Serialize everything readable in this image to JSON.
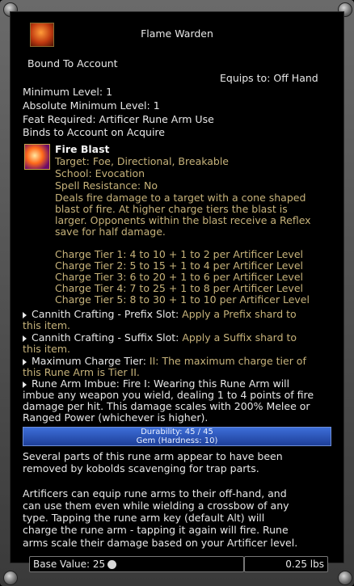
{
  "item": {
    "title": "Flame Warden",
    "bound": "Bound To Account",
    "equips": "Equips to: Off Hand",
    "min_level": "Minimum Level: 1",
    "abs_min_level": "Absolute Minimum Level: 1",
    "feat": "Feat Required: Artificer Rune Arm Use",
    "binds": "Binds to Account on Acquire"
  },
  "spell": {
    "name": "Fire Blast",
    "target": "Target: Foe, Directional, Breakable",
    "school": "School: Evocation",
    "resistance": "Spell Resistance: No",
    "desc": [
      "Deals fire damage to a target with a cone shaped",
      "blast of fire. At higher charge tiers the blast is",
      "larger. Opponents within the blast receive a Reflex",
      "save for half damage."
    ],
    "tiers": [
      "Charge Tier 1: 4 to 10 + 1 to 2 per Artificer Level",
      "Charge Tier 2: 5 to 15 + 1 to 4 per Artificer Level",
      "Charge Tier 3: 6 to 20 + 1 to 6 per Artificer Level",
      "Charge Tier 4: 7 to 25 + 1 to 8 per Artificer Level",
      "Charge Tier 5: 8 to 30 + 1 to 10 per Artificer Level"
    ]
  },
  "effects": [
    {
      "name": "Cannith Crafting - Prefix Slot:",
      "text1": "Apply a Prefix shard to",
      "text2": "this item."
    },
    {
      "name": "Cannith Crafting - Suffix Slot:",
      "text1": "Apply a Suffix shard to",
      "text2": "this item."
    },
    {
      "name": "Maximum Charge Tier:",
      "text1": "II: The maximum charge tier of",
      "text2": "this Rune Arm is Tier II."
    },
    {
      "name": "Rune Arm Imbue: Fire I:",
      "text1": "Wearing this Rune Arm will",
      "text2": "imbue any weapon you wield, dealing 1 to 4 points of fire",
      "text3": "damage per hit. This damage scales with 200% Melee or",
      "text4": "Ranged Power (whichever is higher)."
    }
  ],
  "durability": {
    "label": "Durability: 45 / 45",
    "gem": "Gem (Hardness: 10)",
    "fraction": 1.0,
    "color": "#2f57c0"
  },
  "lore": [
    "Several parts of this rune arm appear to have been",
    "removed by kobolds scavenging for trap parts.",
    "",
    "Artificers can equip rune arms to their off-hand, and",
    "can use them even while wielding a crossbow of any",
    "type. Tapping the rune arm key (default Alt) will",
    "charge the rune arm - tapping it again will fire. Rune",
    "arms scale their damage based on your Artificer level."
  ],
  "footer": {
    "base_value": "Base Value: 25",
    "weight": "0.25 lbs"
  },
  "colors": {
    "gold_text": "#c6b27a",
    "frame": "#5a5a5a"
  }
}
